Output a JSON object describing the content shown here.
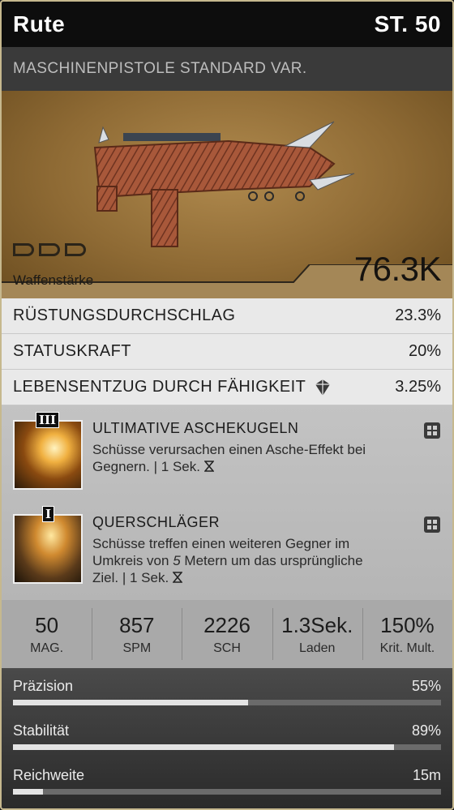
{
  "header": {
    "name": "Rute",
    "level": "ST. 50"
  },
  "subtitle": "MASCHINENPISTOLE STANDARD VAR.",
  "power": {
    "label": "Waffenstärke",
    "value": "76.3K"
  },
  "stats": [
    {
      "label": "RÜSTUNGSDURCHSCHLAG",
      "value": "23.3%"
    },
    {
      "label": "STATUSKRAFT",
      "value": "20%"
    },
    {
      "label": "LEBENSENTZUG DURCH FÄHIGKEIT",
      "value": "3.25%",
      "icon": "shield-gem-icon"
    }
  ],
  "mods": [
    {
      "tier": "III",
      "name": "ULTIMATIVE ASCHEKUGELN",
      "desc_a": "Schüsse verursachen einen Asche-Effekt bei",
      "desc_b": "Gegnern.",
      "cooldown": "| 1 Sek.",
      "icon": "hourglass-icon"
    },
    {
      "tier": "I",
      "name": "QUERSCHLÄGER",
      "desc_a": "Schüsse treffen einen weiteren Gegner im",
      "desc_b": "Umkreis von",
      "desc_num": "5",
      "desc_c": "Metern um das ursprüngliche",
      "desc_d": "Ziel.",
      "cooldown": "| 1 Sek.",
      "icon": "hourglass-icon"
    }
  ],
  "core_stats": [
    {
      "value": "50",
      "label": "MAG."
    },
    {
      "value": "857",
      "label": "SPM"
    },
    {
      "value": "2226",
      "label": "SCH"
    },
    {
      "value": "1.3Sek.",
      "label": "Laden"
    },
    {
      "value": "150%",
      "label": "Krit. Mult."
    }
  ],
  "bars": [
    {
      "label": "Präzision",
      "value": "55%",
      "fill": 0.55
    },
    {
      "label": "Stabilität",
      "value": "89%",
      "fill": 0.89
    },
    {
      "label": "Reichweite",
      "value": "15m",
      "fill": 0.07
    }
  ],
  "colors": {
    "accent": "#c6b88e",
    "header_bg": "#0d0d0d",
    "power_bg": "#a48757"
  }
}
